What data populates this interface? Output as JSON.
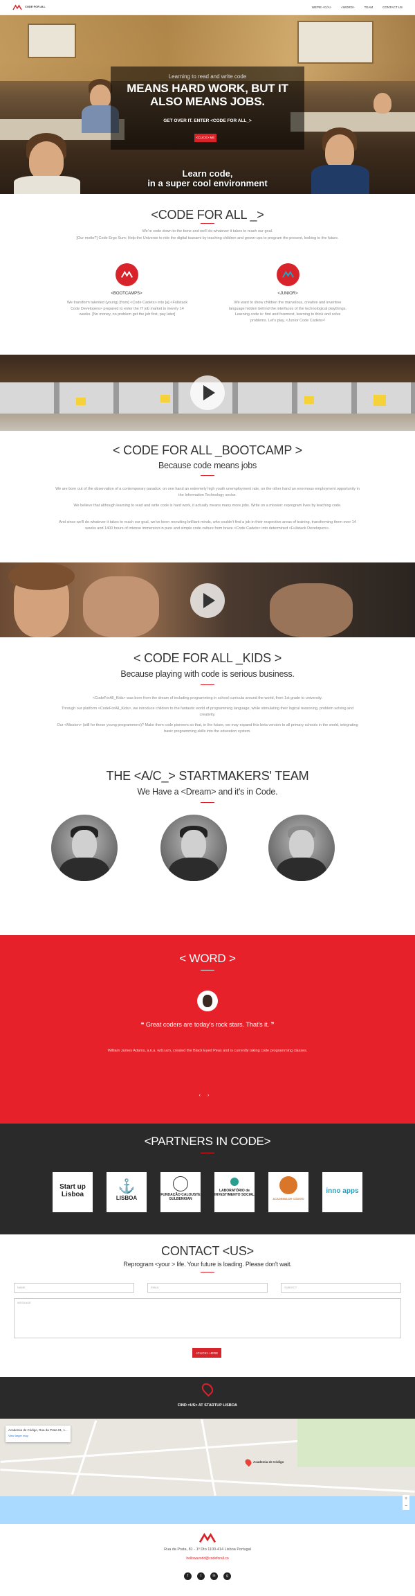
{
  "nav": {
    "logo_text": "CODE FOR ALL",
    "items": [
      "WE'RE <C/A>",
      "<WORD>",
      "TEAM",
      "CONTACT US"
    ]
  },
  "hero": {
    "small": "Learning to read and write code",
    "headline": "MEANS HARD WORK, BUT IT ALSO MEANS JOBS.",
    "cta_text": "GET OVER IT. ENTER <CODE FOR ALL_>",
    "button": "<CLICK> ME",
    "bottom_line1": "Learn code,",
    "bottom_line2": "in a super cool environment"
  },
  "about": {
    "title": "<CODE FOR ALL _>",
    "p1": "We're code down to the bone and we'll do whatever it takes to reach our goal.",
    "p2": "[Our motto?] Code Ergo Sum: Help the Universe to ride the digital tsunami by teaching children and grown-ups to program the present, looking to the future.",
    "bootcamps": {
      "label": "<BOOTCAMPS>",
      "text": "We transform talented (young) [from] <Code Cadets> into [a] <Fullstack Code Developers> prepared to enter the IT job market in merely 14 weeks. [No money, no problem get the job first, pay later]"
    },
    "junior": {
      "label": "<JUNIOR>",
      "text": "We want to show children the marvelous, creative and inventive language hidden behind the interfaces of the technological playthings. Learning code is: first and foremost, learning to think and solve problems. Let's play, <Junior Code Cadets>!"
    }
  },
  "bootcamp": {
    "title": "< CODE FOR ALL _BOOTCAMP >",
    "subtitle": "Because code means jobs",
    "p1": "We are born out of the observation of a contemporary paradox: on one hand an extremely high youth unemployment rate, on the other hand an enormous employment opportunity in the Information Technology sector.",
    "p2": "We believe that although learning to read and write code is hard work, it actually means many more jobs. Write on a mission: reprogram lives by teaching code.",
    "p3": "And since we'll do whatever it takes to reach our goal, we've been recruiting brilliant minds, who couldn't find a job in their respective areas of training, transforming them over 14 weeks and 1400 hours of intense immersion in pure and simple code culture from brave <Code Cadets> into determined <Fullstack Developers>."
  },
  "kids": {
    "title": "< CODE FOR ALL _KIDS >",
    "subtitle": "Because playing with code is serious business.",
    "p1": "<CodeForAll_Kids> was born from the dream of including programming in school curricula around the world, from 1st grade to university.",
    "p2": "Through our platform <CodeForAll_Kids>, we introduce children to the fantastic world of programming language, while stimulating their logical reasoning, problem solving and creativity.",
    "p3": "Our <Mission> (still for these young programmers)? Make them code pioneers so that, in the future, we may expand this beta version to all primary schools in the world, integrating basic programming skills into the education system."
  },
  "team": {
    "title": "THE <A/C_> STARTMAKERS' TEAM",
    "subtitle": "We Have a <Dream> and it's in Code."
  },
  "word": {
    "title": "< WORD >",
    "quote_open": "❝",
    "quote": "Great coders are today's rock stars. That's it.",
    "quote_close": "❞",
    "author": "William James Adams, a.k.a. will.i.am, created the Black Eyed Peas and is currently taking code programming classes.",
    "prev": "‹",
    "next": "›"
  },
  "partners": {
    "title": "<PARTNERS IN CODE>",
    "logos": [
      "Start up Lisboa",
      "LISBOA",
      "FUNDAÇÃO CALOUSTE GULBENKIAN",
      "LABORATÓRIO de INVESTIMENTO SOCIAL",
      "ACADEMIA DE CÓDIGO",
      "inno apps"
    ]
  },
  "contact": {
    "title": "CONTACT <US>",
    "subtitle": "Reprogram <your > life. Your future is loading. Please don't wait.",
    "name_placeholder": "NAME",
    "email_placeholder": "EMAIL",
    "subject_placeholder": "SUBJECT",
    "message_placeholder": "MESSAGE",
    "button": "<CLICK> HERE"
  },
  "find": {
    "text": "FIND <US> AT STARTUP LISBOA"
  },
  "map": {
    "card_title": "Academia de Código, Rua da Prata 81, 1...",
    "card_link": "View larger map",
    "marker_label": "Academia de Código",
    "zoom_in": "+",
    "zoom_out": "−"
  },
  "footer": {
    "address": "Rua da Prata, 81 - 1º Dto 1100-414 Lisboa Portugal",
    "email": "hellowuvorld@codeforall.co",
    "social": [
      "f",
      "t",
      "in",
      "g"
    ]
  },
  "colors": {
    "accent": "#d9232a",
    "dark": "#2a2a2a",
    "word_bg": "#e62129"
  }
}
